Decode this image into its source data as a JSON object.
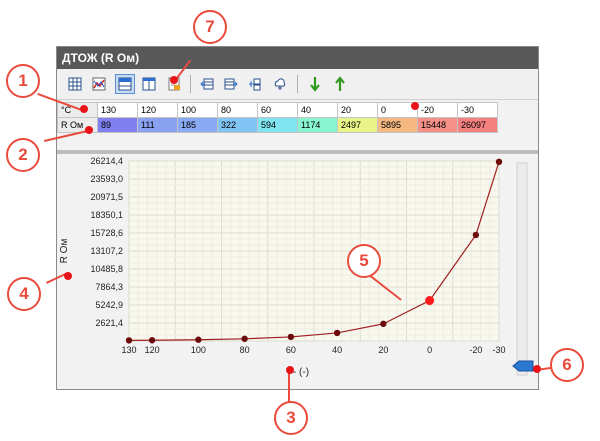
{
  "window": {
    "title": "ДТОЖ (R Ом)"
  },
  "toolbar": {
    "buttons": [
      "grid-icon",
      "chart-icon",
      "horizontal-split-icon",
      "vertical-split-icon",
      "export-icon",
      "table-left-icon",
      "table-right-icon",
      "network-icon",
      "cloud-icon",
      "arrow-down-icon",
      "arrow-up-icon"
    ],
    "active": "horizontal-split-icon"
  },
  "table": {
    "rows": [
      {
        "label": "°C",
        "cells": [
          "130",
          "120",
          "100",
          "80",
          "60",
          "40",
          "20",
          "0",
          "-20",
          "-30"
        ]
      },
      {
        "label": "R Ом",
        "cells": [
          "89",
          "111",
          "185",
          "322",
          "594",
          "1174",
          "2497",
          "5895",
          "15448",
          "26097"
        ],
        "colors": [
          "#8080f0",
          "#8aa0f0",
          "#88aaf4",
          "#80c4f4",
          "#80e4f0",
          "#88f4d0",
          "#e8f488",
          "#f4b880",
          "#f49088",
          "#f48080"
        ]
      }
    ]
  },
  "chart_data": {
    "type": "line",
    "x": [
      130,
      120,
      100,
      80,
      60,
      40,
      20,
      0,
      -20,
      -30
    ],
    "values": [
      89,
      111,
      185,
      322,
      594,
      1174,
      2497,
      5895,
      15448,
      26097
    ],
    "y_ticks": [
      "2621,4",
      "5242,9",
      "7864,3",
      "10485,8",
      "13107,2",
      "15728,6",
      "18350,1",
      "20971,5",
      "23593,0",
      "26214,4"
    ],
    "x_ticks": [
      "130",
      "120",
      "100",
      "80",
      "60",
      "40",
      "20",
      "0",
      "-20",
      "-30"
    ],
    "ylabel": "R Ом",
    "xlabel": "- (-)",
    "ylim": [
      0,
      26214.4
    ],
    "xlim": [
      130,
      -30
    ],
    "grid": true,
    "line_color": "#a02020",
    "marker_color": "#6a0a0a",
    "highlight_index": 7,
    "highlight_color": "#ff1a1a"
  },
  "callouts": [
    "1",
    "2",
    "3",
    "4",
    "5",
    "6",
    "7"
  ],
  "colors": {
    "callout": "#e94b3c",
    "title_bar": "#585858"
  }
}
